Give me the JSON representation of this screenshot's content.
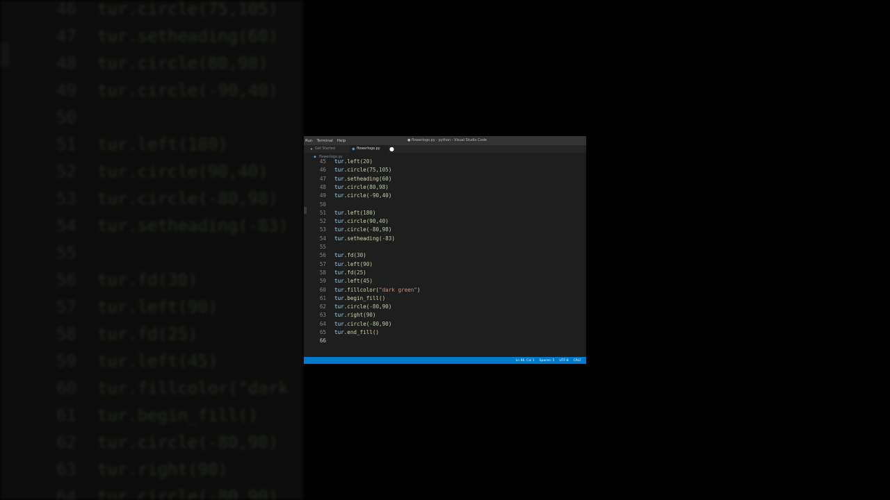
{
  "background": {
    "lines": [
      {
        "num": "46",
        "code": "tur.circle(75,105)"
      },
      {
        "num": "47",
        "code": "tur.setheading(60)"
      },
      {
        "num": "48",
        "code": "tur.circle(80,98)"
      },
      {
        "num": "49",
        "code": "tur.circle(-90,40)"
      },
      {
        "num": "50",
        "code": ""
      },
      {
        "num": "51",
        "code": "tur.left(180)"
      },
      {
        "num": "52",
        "code": "tur.circle(90,40)"
      },
      {
        "num": "53",
        "code": "tur.circle(-80,98)"
      },
      {
        "num": "54",
        "code": "tur.setheading(-83)"
      },
      {
        "num": "55",
        "code": ""
      },
      {
        "num": "56",
        "code": "tur.fd(30)"
      },
      {
        "num": "57",
        "code": "tur.left(90)"
      },
      {
        "num": "58",
        "code": "tur.fd(25)"
      },
      {
        "num": "59",
        "code": "tur.left(45)"
      },
      {
        "num": "60",
        "code": "tur.fillcolor(\"dark"
      },
      {
        "num": "61",
        "code": "tur.begin_fill()"
      },
      {
        "num": "62",
        "code": "tur.circle(-80,90)"
      },
      {
        "num": "63",
        "code": "tur.right(90)"
      },
      {
        "num": "64",
        "code": "tur.circle(-80,90)"
      }
    ]
  },
  "window": {
    "menu": [
      "Run",
      "Terminal",
      "Help"
    ],
    "title": "● flowerlogo.py - python - Visual Studio Code"
  },
  "tabs": [
    {
      "label": "Get Started",
      "icon": "vscode-icon",
      "active": false
    },
    {
      "label": "flowerlogo.py",
      "icon": "python-icon",
      "active": true,
      "modified": true
    }
  ],
  "breadcrumb": "flowerlogo.py",
  "editor": {
    "lines": [
      {
        "num": "45",
        "code": "tur.left(20)"
      },
      {
        "num": "46",
        "code": "tur.circle(75,105)"
      },
      {
        "num": "47",
        "code": "tur.setheading(60)"
      },
      {
        "num": "48",
        "code": "tur.circle(80,98)"
      },
      {
        "num": "49",
        "code": "tur.circle(-90,40)"
      },
      {
        "num": "50",
        "code": ""
      },
      {
        "num": "51",
        "code": "tur.left(180)"
      },
      {
        "num": "52",
        "code": "tur.circle(90,40)"
      },
      {
        "num": "53",
        "code": "tur.circle(-80,98)"
      },
      {
        "num": "54",
        "code": "tur.setheading(-83)"
      },
      {
        "num": "55",
        "code": ""
      },
      {
        "num": "56",
        "code": "tur.fd(30)"
      },
      {
        "num": "57",
        "code": "tur.left(90)"
      },
      {
        "num": "58",
        "code": "tur.fd(25)"
      },
      {
        "num": "59",
        "code": "tur.left(45)"
      },
      {
        "num": "60",
        "code": "tur.fillcolor(\"dark green\")"
      },
      {
        "num": "61",
        "code": "tur.begin_fill()"
      },
      {
        "num": "62",
        "code": "tur.circle(-80,90)"
      },
      {
        "num": "63",
        "code": "tur.right(90)"
      },
      {
        "num": "64",
        "code": "tur.circle(-80,90)"
      },
      {
        "num": "65",
        "code": "tur.end_fill()"
      },
      {
        "num": "66",
        "code": ""
      }
    ],
    "active_line": "66"
  },
  "statusbar": {
    "position": "Ln 66, Col 1",
    "spaces": "Spaces: 5",
    "encoding": "UTF-8",
    "eol": "CRLF"
  },
  "colors": {
    "statusbar": "#007acc",
    "editor_bg": "#1e1e1e",
    "keyword_object": "#9cdcfe",
    "string": "#ce9178"
  }
}
